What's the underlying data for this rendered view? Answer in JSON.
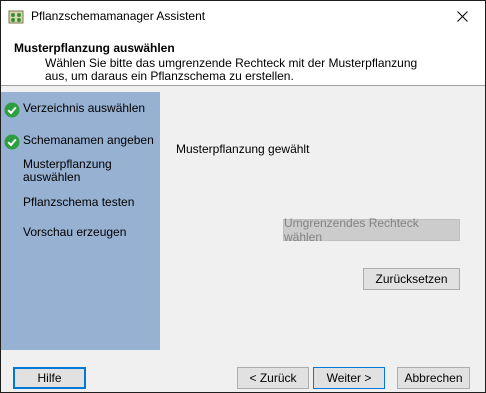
{
  "window": {
    "title": "Pflanzschemamanager Assistent"
  },
  "header": {
    "title": "Musterpflanzung auswählen",
    "description": "Wählen Sie bitte das umgrenzende Rechteck mit der Musterpflanzung aus, um daraus ein Pflanzschema zu erstellen."
  },
  "steps": [
    {
      "label": "Verzeichnis auswählen",
      "done": true
    },
    {
      "label": "Schemanamen angeben",
      "done": true
    },
    {
      "label": "Musterpflanzung auswählen",
      "done": false
    },
    {
      "label": "Pflanzschema testen",
      "done": false
    },
    {
      "label": "Vorschau erzeugen",
      "done": false
    }
  ],
  "content": {
    "status": "Musterpflanzung gewählt",
    "select_rect_label": "Umgrenzendes Rechteck wählen",
    "reset_label": "Zurücksetzen"
  },
  "footer": {
    "help_label": "Hilfe",
    "back_label": "< Zurück",
    "next_label": "Weiter >",
    "cancel_label": "Abbrechen"
  },
  "colors": {
    "sidebar": "#97b1d2",
    "check": "#2e9e3e",
    "accent": "#0078d7"
  }
}
